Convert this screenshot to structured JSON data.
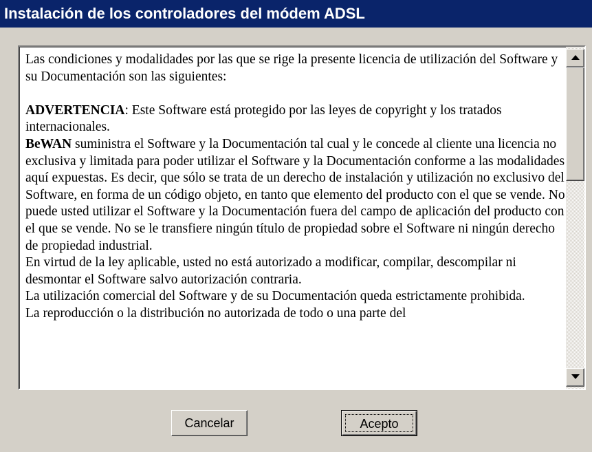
{
  "window": {
    "title": "Instalación de los controladores del módem ADSL"
  },
  "license": {
    "intro": "Las condiciones y modalidades por las que se rige la presente licencia de utilización del Software y su Documentación son las siguientes:",
    "warning_label": "ADVERTENCIA",
    "warning_text": ": Este Software está protegido por las leyes de copyright y los tratados internacionales.",
    "company": "BeWAN",
    "company_text": " suministra el Software y la Documentación tal cual y le concede al cliente una licencia no exclusiva y limitada para poder utilizar el Software y la Documentación conforme a las modalidades aquí expuestas. Es decir, que sólo se trata de un derecho de instalación y utilización no exclusivo del Software, en forma de un código objeto, en tanto que elemento del producto con el que se vende. No puede usted utilizar el Software y la Documentación fuera del campo de aplicación del producto con el que se vende. No se le transfiere ningún título de propiedad sobre el Software ni ningún derecho de propiedad industrial.",
    "para_law": "En virtud de la ley aplicable, usted no está autorizado a modificar, compilar, descompilar ni desmontar el Software salvo autorización contraria.",
    "para_commercial": "La utilización comercial del Software y de su Documentación queda estrictamente prohibida.",
    "para_reproduction": "La reproducción o la distribución no autorizada de todo o una parte del"
  },
  "scrollbar": {
    "up_icon": "arrow-up-icon",
    "down_icon": "arrow-down-icon",
    "position": 0
  },
  "buttons": {
    "cancel_label": "Cancelar",
    "accept_label": "Acepto"
  },
  "colors": {
    "titlebar": "#0a246a",
    "face": "#d4d0c8"
  }
}
